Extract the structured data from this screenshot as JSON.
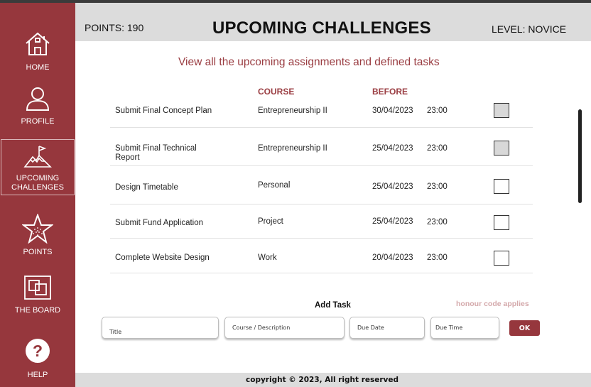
{
  "header": {
    "points": "POINTS: 190",
    "title": "UPCOMING CHALLENGES",
    "level": "LEVEL: NOVICE"
  },
  "sidebar": {
    "items": [
      {
        "label": "HOME",
        "icon": "home-icon"
      },
      {
        "label": "PROFILE",
        "icon": "user-icon"
      },
      {
        "label": "UPCOMING\nCHALLENGES",
        "icon": "mountain-flag-icon",
        "active": true
      },
      {
        "label": "POINTS",
        "icon": "star-icon"
      },
      {
        "label": "THE BOARD",
        "icon": "board-icon"
      },
      {
        "label": "HELP",
        "icon": "help-icon"
      }
    ]
  },
  "main": {
    "subtitle": "View all the upcoming assignments and defined tasks",
    "columns": {
      "course": "COURSE",
      "before": "BEFORE"
    },
    "tasks": [
      {
        "task": "Submit Final Concept Plan",
        "course": "Entrepreneurship II",
        "date": "30/04/2023",
        "time": "23:00",
        "checked": true
      },
      {
        "task": "Submit Final Technical Report",
        "course": "Entrepreneurship II",
        "date": "25/04/2023",
        "time": "23:00",
        "checked": true
      },
      {
        "task": "Design Timetable",
        "course": "Personal",
        "date": "25/04/2023",
        "time": "23:00",
        "checked": false
      },
      {
        "task": "Submit Fund Application",
        "course": "Project",
        "date": "25/04/2023",
        "time": "23:00",
        "checked": false
      },
      {
        "task": "Complete Website Design",
        "course": "Work",
        "date": "20/04/2023",
        "time": "23:00",
        "checked": false
      }
    ]
  },
  "add_task": {
    "heading": "Add Task",
    "honour": "honour code applies",
    "title_placeholder": "Title",
    "course_placeholder": "Course / Description",
    "date_placeholder": "Due Date",
    "time_placeholder": "Due Time",
    "ok_label": "OK"
  },
  "footer": {
    "copyright": "copyright © 2023, All right reserved"
  },
  "colors": {
    "accent": "#96373d",
    "header_bg": "#dcdcdc",
    "subtitle": "#9a3d42"
  }
}
